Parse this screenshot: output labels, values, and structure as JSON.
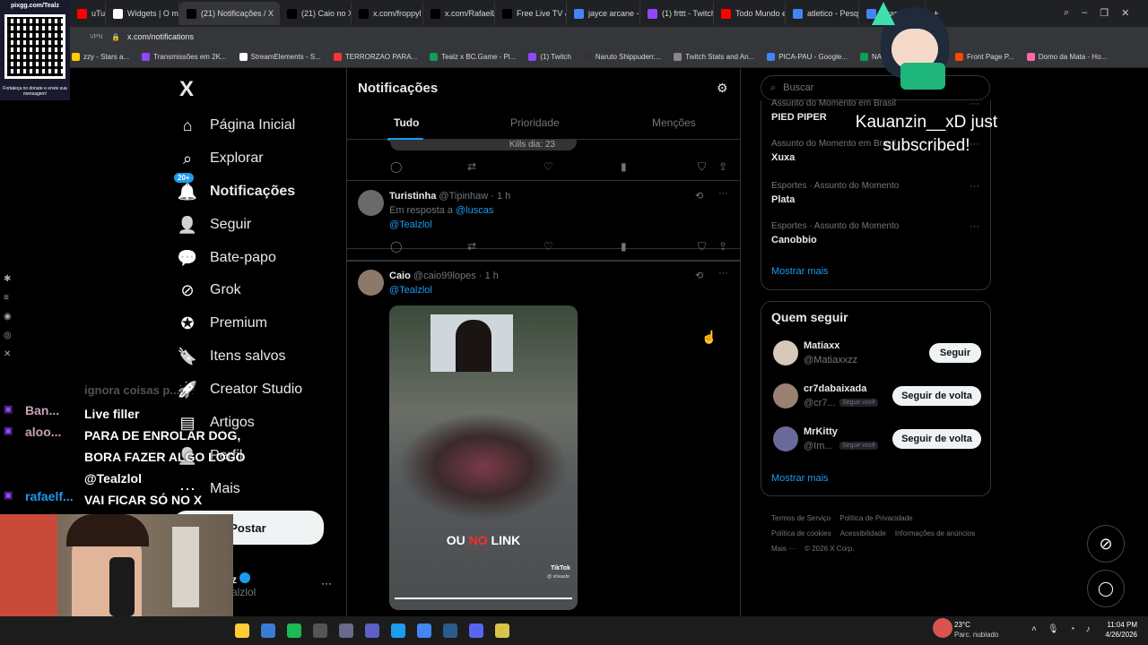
{
  "browser": {
    "tabs": [
      {
        "label": "uTube",
        "color": "#ff0000"
      },
      {
        "label": "Widgets | O me",
        "color": "#ffffff"
      },
      {
        "label": "(21) Notificações / X",
        "color": "#000000",
        "active": true
      },
      {
        "label": "(21) Caio no X:",
        "color": "#000000"
      },
      {
        "label": "x.com/froppyl",
        "color": "#000000"
      },
      {
        "label": "x.com/RafaelLu",
        "color": "#000000"
      },
      {
        "label": "Free Live TV & I",
        "color": "#000000"
      },
      {
        "label": "jayce arcane - P",
        "color": "#4285f4"
      },
      {
        "label": "(1) frttt - Twitch",
        "color": "#9146ff"
      },
      {
        "label": "Todo Mundo e",
        "color": "#ff0000"
      },
      {
        "label": "atletico - Pesq",
        "color": "#4285f4"
      },
      {
        "label": "quando lança a",
        "color": "#4285f4"
      }
    ],
    "new_tab": "+",
    "vpn_label": "VPN",
    "url": "x.com/notifications",
    "bookmarks": [
      {
        "label": "zzy - Stars a...",
        "color": "#ffcc00"
      },
      {
        "label": "Transmissões em 2K...",
        "color": "#9146ff"
      },
      {
        "label": "StreamElements - S...",
        "color": "#ffffff"
      },
      {
        "label": "TERRORZAO PARA...",
        "color": "#ff3333"
      },
      {
        "label": "Tealz x BC.Game - Pl...",
        "color": "#0f9d58"
      },
      {
        "label": "(1) Twitch",
        "color": "#9146ff"
      },
      {
        "label": "Naruto Shippuden:...",
        "color": "#333333"
      },
      {
        "label": "Twitch Stats and An...",
        "color": "#888888"
      },
      {
        "label": "PICA-PAU - Google...",
        "color": "#4285f4"
      },
      {
        "label": "NATAL DO EMO - G...",
        "color": "#0f9d58"
      },
      {
        "label": "Front Page P...",
        "color": "#ff4500"
      },
      {
        "label": "Domo da Mata - Ho...",
        "color": "#ff66aa"
      }
    ]
  },
  "overlay": {
    "qr_header": "pixgg.com/Tealz",
    "qr_footer": "Fortaleça no donate e envie sua mensagem!",
    "sub_alert": "Kauanzin__xD just subscribed!",
    "chat": [
      {
        "user": "Ban...",
        "message": "Live filler"
      },
      {
        "user": "aloo...",
        "message": "PARA DE ENROLAR DOG, BORA FAZER ALGO LOGO @Tealzlol"
      },
      {
        "user": "rafaelf...",
        "message": "VAI FICAR SÓ NO X"
      }
    ],
    "chat_top_partial": "ignora coisas p..."
  },
  "nav": {
    "logo": "X",
    "items": [
      {
        "label": "Página Inicial",
        "icon": "home-icon"
      },
      {
        "label": "Explorar",
        "icon": "search-icon"
      },
      {
        "label": "Notificações",
        "icon": "bell-icon",
        "badge": "20+"
      },
      {
        "label": "Seguir",
        "icon": "person-add-icon"
      },
      {
        "label": "Bate-papo",
        "icon": "chat-icon"
      },
      {
        "label": "Grok",
        "icon": "grok-icon"
      },
      {
        "label": "Premium",
        "icon": "verified-icon"
      },
      {
        "label": "Itens salvos",
        "icon": "bookmark-icon"
      },
      {
        "label": "Creator Studio",
        "icon": "rocket-icon"
      },
      {
        "label": "Artigos",
        "icon": "article-icon"
      },
      {
        "label": "Perfil",
        "icon": "profile-icon"
      },
      {
        "label": "Mais",
        "icon": "more-icon"
      }
    ],
    "post_button": "Postar",
    "account_name_partial": "z",
    "account_handle_partial": "alzlol"
  },
  "center": {
    "title": "Notificações",
    "tabs": [
      "Tudo",
      "Prioridade",
      "Menções"
    ],
    "top_partial_text": "Kills dia: 23",
    "posts": [
      {
        "name": "Turistinha",
        "handle": "@Tipinhaw",
        "time": "· 1 h",
        "reply_prefix": "Em resposta a",
        "reply_to": "@luscas",
        "mention": "@Tealzlol"
      },
      {
        "name": "Caio",
        "handle": "@caio99lopes",
        "time": "· 1 h",
        "mention": "@Tealzlol",
        "video_caption_1": "OU",
        "video_caption_2": "NO",
        "video_caption_3": "LINK",
        "video_brand": "TikTok",
        "video_user": "@ shivasbr"
      }
    ]
  },
  "right": {
    "search_placeholder": "Buscar",
    "trends": [
      {
        "category": "Assunto do Momento em Brasil",
        "name": "PIED PIPER"
      },
      {
        "category": "Assunto do Momento em Brasil",
        "name": "Xuxa"
      },
      {
        "category": "Esportes · Assunto do Momento",
        "name": "Plata"
      },
      {
        "category": "Esportes · Assunto do Momento",
        "name": "Canobbio"
      }
    ],
    "show_more": "Mostrar mais",
    "who_to_follow_title": "Quem seguir",
    "who_to_follow": [
      {
        "name": "Matiaxx",
        "handle": "@Matiaxxzz",
        "button": "Seguir",
        "follows_you": ""
      },
      {
        "name": "cr7dabaixada",
        "handle": "@cr7...",
        "button": "Seguir de volta",
        "follows_you": "Segue você"
      },
      {
        "name": "MrKitty",
        "handle": "@Im...",
        "button": "Seguir de volta",
        "follows_you": "Segue você"
      }
    ],
    "show_more_2": "Mostrar mais",
    "footer": [
      "Termos de Serviço",
      "Política de Privacidade",
      "Política de cookies",
      "Acessibilidade",
      "Informações de anúncios",
      "Mais ···",
      "© 2026 X Corp."
    ]
  },
  "taskbar": {
    "temperature": "23°C",
    "weather": "Parc. nublado",
    "time": "11:04 PM",
    "date": "4/26/2026"
  }
}
